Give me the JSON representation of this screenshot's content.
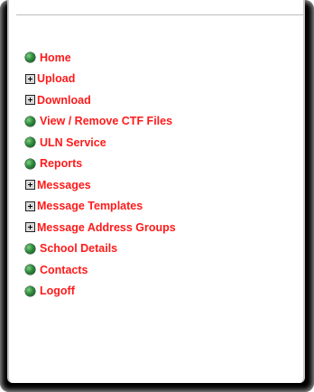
{
  "menu": {
    "items": [
      {
        "label": "Home",
        "icon": "bullet-icon"
      },
      {
        "label": "Upload",
        "icon": "expand-icon"
      },
      {
        "label": "Download",
        "icon": "expand-icon"
      },
      {
        "label": "View / Remove CTF Files",
        "icon": "bullet-icon"
      },
      {
        "label": "ULN Service",
        "icon": "bullet-icon"
      },
      {
        "label": "Reports",
        "icon": "bullet-icon"
      },
      {
        "label": "Messages",
        "icon": "expand-icon"
      },
      {
        "label": "Message Templates",
        "icon": "expand-icon"
      },
      {
        "label": "Message Address Groups",
        "icon": "expand-icon"
      },
      {
        "label": "School Details",
        "icon": "bullet-icon"
      },
      {
        "label": "Contacts",
        "icon": "bullet-icon"
      },
      {
        "label": "Logoff",
        "icon": "bullet-icon"
      }
    ]
  },
  "colors": {
    "link": "#ff1a1a",
    "bullet": "#2e8b3e",
    "frame": "#000000",
    "panel": "#ffffff"
  }
}
